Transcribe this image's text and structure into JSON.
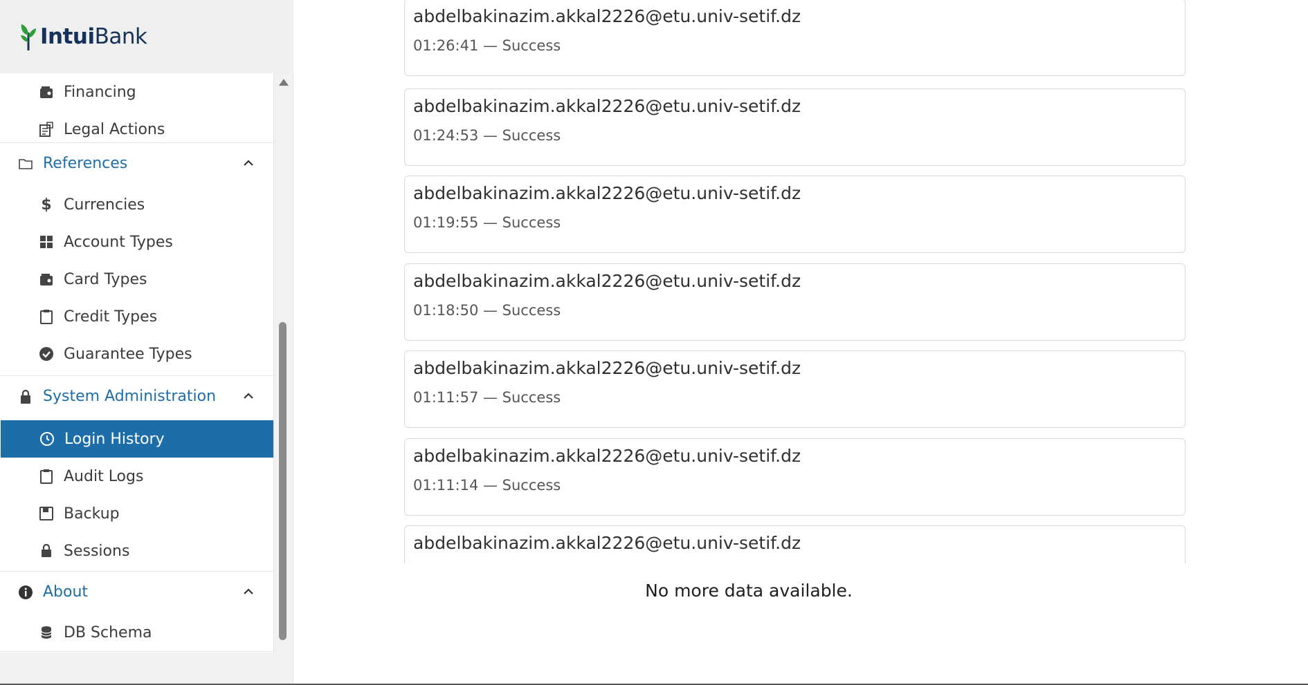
{
  "brand": {
    "name_bold": "Intui",
    "name_rest": "Bank"
  },
  "sidebar": {
    "items_top": [
      {
        "label": "Financing",
        "icon": "wallet-icon"
      },
      {
        "label": "Legal Actions",
        "icon": "document-icon"
      }
    ],
    "references": {
      "label": "References",
      "icon": "folder-icon",
      "items": [
        {
          "label": "Currencies",
          "icon": "dollar-icon"
        },
        {
          "label": "Account Types",
          "icon": "grid-icon"
        },
        {
          "label": "Card Types",
          "icon": "wallet-icon"
        },
        {
          "label": "Credit Types",
          "icon": "clipboard-icon"
        },
        {
          "label": "Guarantee Types",
          "icon": "check-circle-icon"
        }
      ]
    },
    "system_admin": {
      "label": "System Administration",
      "icon": "lock-icon",
      "items": [
        {
          "label": "Login History",
          "icon": "clock-icon",
          "active": true
        },
        {
          "label": "Audit Logs",
          "icon": "clipboard-icon"
        },
        {
          "label": "Backup",
          "icon": "save-icon"
        },
        {
          "label": "Sessions",
          "icon": "lock-icon"
        }
      ]
    },
    "about": {
      "label": "About",
      "icon": "info-icon",
      "items": [
        {
          "label": "DB Schema",
          "icon": "database-icon"
        }
      ]
    }
  },
  "login_history": [
    {
      "email": "abdelbakinazim.akkal2226@etu.univ-setif.dz",
      "meta": "01:26:41 — Success"
    },
    {
      "email": "abdelbakinazim.akkal2226@etu.univ-setif.dz",
      "meta": "01:24:53 — Success"
    },
    {
      "email": "abdelbakinazim.akkal2226@etu.univ-setif.dz",
      "meta": "01:19:55 — Success"
    },
    {
      "email": "abdelbakinazim.akkal2226@etu.univ-setif.dz",
      "meta": "01:18:50 — Success"
    },
    {
      "email": "abdelbakinazim.akkal2226@etu.univ-setif.dz",
      "meta": "01:11:57 — Success"
    },
    {
      "email": "abdelbakinazim.akkal2226@etu.univ-setif.dz",
      "meta": "01:11:14 — Success"
    },
    {
      "email": "abdelbakinazim.akkal2226@etu.univ-setif.dz",
      "meta": ""
    }
  ],
  "no_more_text": "No more data available.",
  "colors": {
    "accent": "#1d6ea8",
    "brand_dark": "#15325a",
    "brand_leaf": "#2e9e3a"
  }
}
